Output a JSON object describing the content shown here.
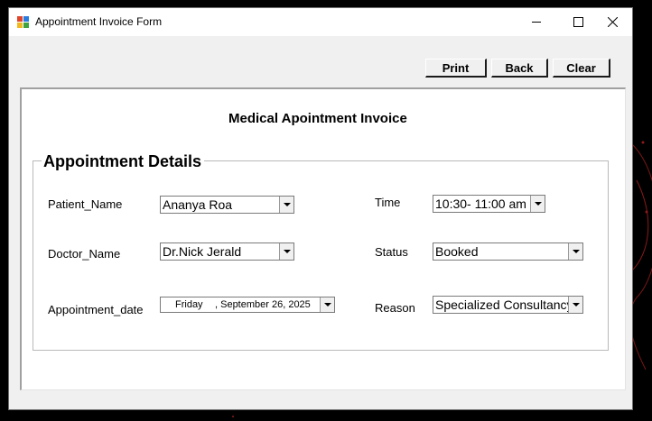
{
  "window": {
    "title": "Appointment Invoice Form"
  },
  "toolbar": {
    "print_label": "Print",
    "back_label": "Back",
    "clear_label": "Clear"
  },
  "form": {
    "heading": "Medical Apointment Invoice",
    "group_title": "Appointment Details",
    "fields": {
      "patient_name": {
        "label": "Patient_Name",
        "value": "Ananya Roa"
      },
      "doctor_name": {
        "label": "Doctor_Name",
        "value": "Dr.Nick Jerald"
      },
      "appointment_date": {
        "label": "Appointment_date",
        "day": "Friday",
        "date": ", September 26, 2025"
      },
      "time": {
        "label": "Time",
        "value": "10:30- 11:00 am"
      },
      "status": {
        "label": "Status",
        "value": "Booked"
      },
      "reason": {
        "label": "Reason",
        "value": "Specialized Consultancy"
      }
    }
  },
  "colors": {
    "window_bg": "#f0f0f0",
    "panel_bg": "#ffffff",
    "desktop_bg": "#000000",
    "decoration": "#8b1a1a"
  }
}
